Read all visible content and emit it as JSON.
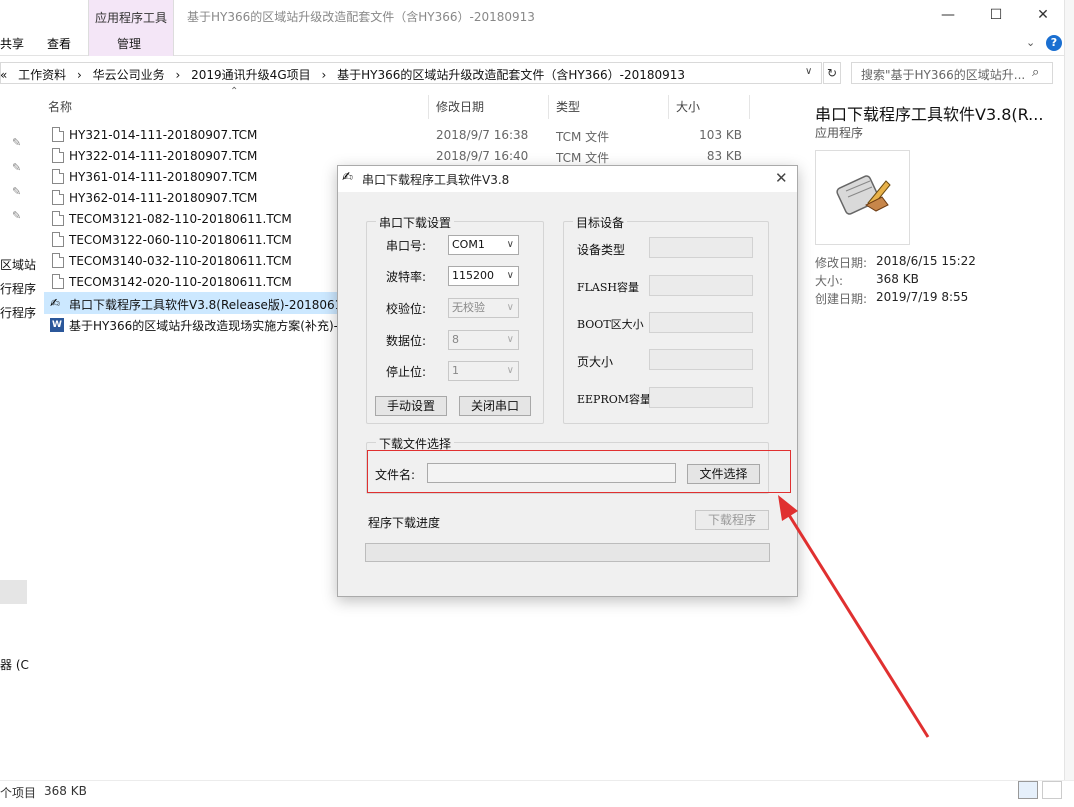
{
  "window": {
    "title": "基于HY366的区域站升级改造配套文件（含HY366）-20180913",
    "context_tab": "应用程序工具",
    "tabs": [
      "共享",
      "查看",
      "管理"
    ],
    "controls": {
      "minimize": "—",
      "maximize": "☐",
      "close": "✕"
    }
  },
  "address": {
    "back": "«",
    "crumbs": [
      "工作资料",
      "›",
      "华云公司业务",
      "›",
      "2019通讯升级4G项目",
      "›",
      "基于HY366的区域站升级改造配套文件（含HY366）-20180913"
    ],
    "search_placeholder": "搜索\"基于HY366的区域站升..."
  },
  "left_nav": {
    "fragments": [
      "区域站",
      "行程序",
      "行程序",
      "器 (C"
    ]
  },
  "columns": {
    "name": "名称",
    "date": "修改日期",
    "type": "类型",
    "size": "大小"
  },
  "files": [
    {
      "name": "HY321-014-111-20180907.TCM",
      "date": "2018/9/7 16:38",
      "type": "TCM 文件",
      "size": "103 KB"
    },
    {
      "name": "HY322-014-111-20180907.TCM",
      "date": "2018/9/7 16:40",
      "type": "TCM 文件",
      "size": "83 KB"
    },
    {
      "name": "HY361-014-111-20180907.TCM",
      "date": "",
      "type": "",
      "size": ""
    },
    {
      "name": "HY362-014-111-20180907.TCM",
      "date": "",
      "type": "",
      "size": ""
    },
    {
      "name": "TECOM3121-082-110-20180611.TCM",
      "date": "",
      "type": "",
      "size": ""
    },
    {
      "name": "TECOM3122-060-110-20180611.TCM",
      "date": "",
      "type": "",
      "size": ""
    },
    {
      "name": "TECOM3140-032-110-20180611.TCM",
      "date": "",
      "type": "",
      "size": ""
    },
    {
      "name": "TECOM3142-020-110-20180611.TCM",
      "date": "",
      "type": "",
      "size": ""
    },
    {
      "name": "串口下载程序工具软件V3.8(Release版)-20180615",
      "date": "",
      "type": "",
      "size": ""
    },
    {
      "name": "基于HY366的区域站升级改造现场实施方案(补充)-2",
      "date": "",
      "type": "",
      "size": ""
    }
  ],
  "preview": {
    "title": "串口下载程序工具软件V3.8(R...",
    "subtitle": "应用程序",
    "props": [
      {
        "label": "修改日期:",
        "value": "2018/6/15 15:22"
      },
      {
        "label": "大小:",
        "value": "368 KB"
      },
      {
        "label": "创建日期:",
        "value": "2019/7/19 8:55"
      }
    ]
  },
  "status": {
    "items": "个项目",
    "size": "368 KB"
  },
  "dialog": {
    "title": "串口下载程序工具软件V3.8",
    "close": "✕",
    "serial_group": "串口下载设置",
    "port_label": "串口号:",
    "port_value": "COM1",
    "baud_label": "波特率:",
    "baud_value": "115200",
    "parity_label": "校验位:",
    "parity_value": "无校验",
    "databits_label": "数据位:",
    "databits_value": "8",
    "stopbits_label": "停止位:",
    "stopbits_value": "1",
    "manual_btn": "手动设置",
    "close_port_btn": "关闭串口",
    "target_group": "目标设备",
    "target_fields": [
      "设备类型",
      "FLASH容量",
      "BOOT区大小",
      "页大小",
      "EEPROM容量"
    ],
    "file_group": "下载文件选择",
    "file_label": "文件名:",
    "file_btn": "文件选择",
    "progress_label": "程序下载进度",
    "download_btn": "下载程序",
    "progress": 0
  },
  "annotation": {
    "color": "#e03030"
  }
}
